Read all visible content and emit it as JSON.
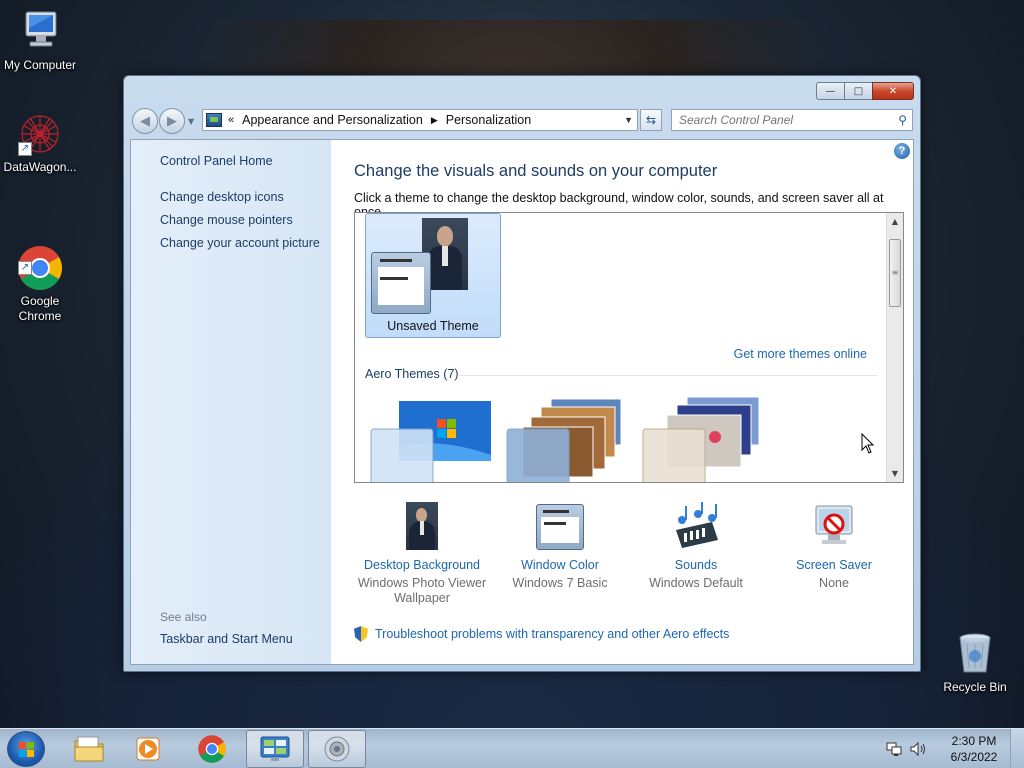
{
  "desktop": {
    "icons": [
      {
        "label": "My Computer",
        "icon": "computer-icon"
      },
      {
        "label": "DataWagon...",
        "icon": "datawagon-icon"
      },
      {
        "label": "Google\nChrome",
        "icon": "chrome-icon"
      },
      {
        "label": "Recycle Bin",
        "icon": "recycle-bin-icon"
      }
    ]
  },
  "window": {
    "title_buttons": {
      "minimize": "—",
      "maximize": "□",
      "close": "✕"
    },
    "address": {
      "chevron": "«",
      "crumbs": [
        "Appearance and Personalization",
        "Personalization"
      ],
      "separator": "▶"
    },
    "search": {
      "placeholder": "Search Control Panel"
    },
    "left_pane": {
      "home_link": "Control Panel Home",
      "links": [
        "Change desktop icons",
        "Change mouse pointers",
        "Change your account picture"
      ],
      "see_also_title": "See also",
      "see_also_links": [
        "Taskbar and Start Menu"
      ]
    },
    "main": {
      "title": "Change the visuals and sounds on your computer",
      "description": "Click a theme to change the desktop background, window color, sounds, and screen saver all at once.",
      "selected_theme": "Unsaved Theme",
      "get_more_link": "Get more themes online",
      "group_header": "Aero Themes (7)",
      "bottom_items": [
        {
          "title": "Desktop Background",
          "sub": "Windows Photo Viewer Wallpaper",
          "icon": "desktop-background-icon"
        },
        {
          "title": "Window Color",
          "sub": "Windows 7 Basic",
          "icon": "window-color-icon"
        },
        {
          "title": "Sounds",
          "sub": "Windows Default",
          "icon": "sounds-icon"
        },
        {
          "title": "Screen Saver",
          "sub": "None",
          "icon": "screen-saver-icon"
        }
      ],
      "troubleshoot_link": "Troubleshoot problems with transparency and other Aero effects",
      "help": "?"
    }
  },
  "taskbar": {
    "items": [
      "start-button",
      "file-explorer",
      "media-player",
      "google-chrome",
      "control-panel",
      "sounds"
    ],
    "clock": {
      "time": "2:30 PM",
      "date": "6/3/2022"
    }
  }
}
